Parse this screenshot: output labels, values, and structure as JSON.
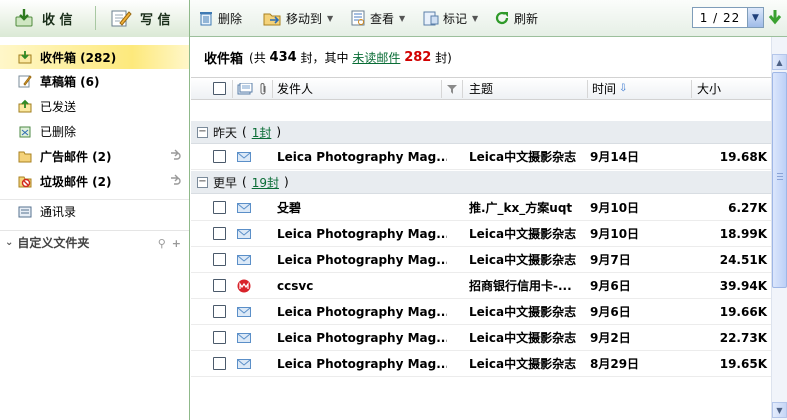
{
  "toolbar": {
    "receive_label": "收 信",
    "write_label": "写 信",
    "delete_label": "删除",
    "move_label": "移动到",
    "view_label": "查看",
    "mark_label": "标记",
    "refresh_label": "刷新",
    "page_value": "1 / 22"
  },
  "sidebar": {
    "items": [
      {
        "label": "收件箱 (282)",
        "icon": "inbox-icon"
      },
      {
        "label": "草稿箱 (6)",
        "icon": "drafts-icon"
      },
      {
        "label": "已发送",
        "icon": "sent-icon"
      },
      {
        "label": "已删除",
        "icon": "trash-icon"
      },
      {
        "label": "广告邮件 (2)",
        "icon": "ad-folder-icon"
      },
      {
        "label": "垃圾邮件 (2)",
        "icon": "spam-icon"
      },
      {
        "label": "通讯录",
        "icon": "contacts-icon"
      }
    ],
    "custom_folders_label": "自定义文件夹"
  },
  "main": {
    "title": "收件箱",
    "summary_prefix": "(共",
    "total": "434",
    "summary_mid": "封，其中",
    "unread_link": "未读邮件",
    "unread_count": "282",
    "summary_suffix": "封)"
  },
  "columns": {
    "sender": "发件人",
    "subject": "主题",
    "time": "时间",
    "size": "大小"
  },
  "groups": [
    {
      "label": "昨天",
      "count": "1封"
    },
    {
      "label": "更早",
      "count": "19封"
    }
  ],
  "rows": [
    {
      "sender": "Leica Photography Mag...",
      "subject": "Leica中文摄影杂志",
      "date": "9月14日",
      "size": "19.68K",
      "icon": "mail-icon"
    },
    {
      "sender": "殳碧",
      "subject": "推.广_kx_方案uqt",
      "date": "9月10日",
      "size": "6.27K",
      "icon": "mail-icon"
    },
    {
      "sender": "Leica Photography Mag...",
      "subject": "Leica中文摄影杂志",
      "date": "9月10日",
      "size": "18.99K",
      "icon": "mail-icon"
    },
    {
      "sender": "Leica Photography Mag...",
      "subject": "Leica中文摄影杂志",
      "date": "9月7日",
      "size": "24.51K",
      "icon": "mail-icon"
    },
    {
      "sender": "ccsvc",
      "subject": "招商银行信用卡-...",
      "date": "9月6日",
      "size": "39.94K",
      "icon": "cmb-logo-icon"
    },
    {
      "sender": "Leica Photography Mag...",
      "subject": "Leica中文摄影杂志",
      "date": "9月6日",
      "size": "19.66K",
      "icon": "mail-icon"
    },
    {
      "sender": "Leica Photography Mag...",
      "subject": "Leica中文摄影杂志",
      "date": "9月2日",
      "size": "22.73K",
      "icon": "mail-icon"
    },
    {
      "sender": "Leica Photography Mag...",
      "subject": "Leica中文摄影杂志",
      "date": "8月29日",
      "size": "19.65K",
      "icon": "mail-icon"
    }
  ],
  "colors": {
    "accent_green": "#0a6d36",
    "unread_red": "#d10000",
    "selected_folder": "#fde97c"
  }
}
